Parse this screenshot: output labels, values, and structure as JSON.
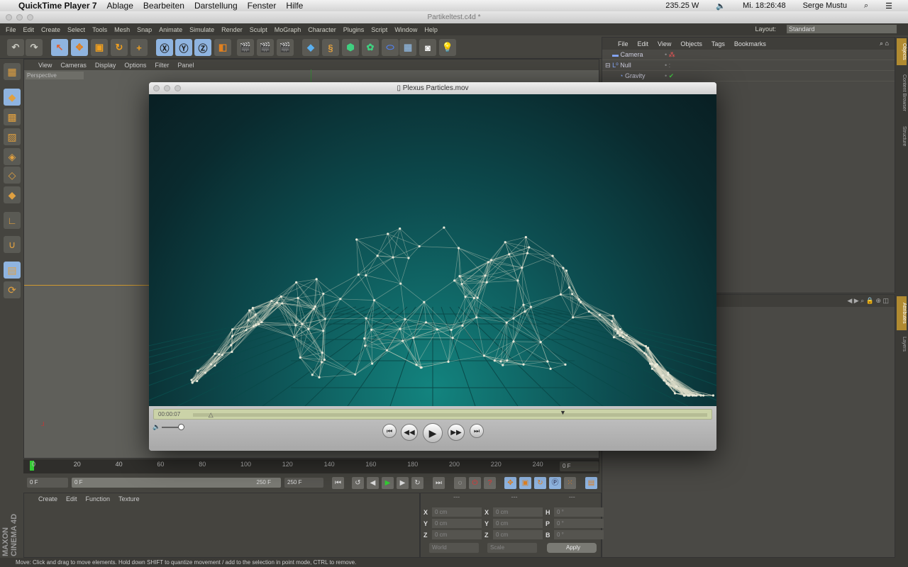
{
  "mac_menubar": {
    "app": "QuickTime Player 7",
    "items": [
      "Ablage",
      "Bearbeiten",
      "Darstellung",
      "Fenster",
      "Hilfe"
    ],
    "power": "235.25 W",
    "clock": "Mi. 18:26:48",
    "user": "Serge Mustu"
  },
  "c4d": {
    "title": "Partikeltest.c4d *",
    "menu": [
      "File",
      "Edit",
      "Create",
      "Select",
      "Tools",
      "Mesh",
      "Snap",
      "Animate",
      "Simulate",
      "Render",
      "Sculpt",
      "MoGraph",
      "Character",
      "Plugins",
      "Script",
      "Window",
      "Help"
    ],
    "layout_label": "Layout:",
    "layout_value": "Standard",
    "viewport_menu": [
      "View",
      "Cameras",
      "Display",
      "Options",
      "Filter",
      "Panel"
    ],
    "viewport_label": "Perspective",
    "object_manager": {
      "menu": [
        "File",
        "Edit",
        "View",
        "Objects",
        "Tags",
        "Bookmarks"
      ],
      "objects": [
        {
          "name": "Camera"
        },
        {
          "name": "Null"
        },
        {
          "name": "Gravity"
        }
      ]
    },
    "right_tabs": [
      "Objects",
      "Content Browser",
      "Structure",
      "Attributes",
      "Layers"
    ],
    "timeline": {
      "ticks": [
        "0",
        "20",
        "40",
        "60",
        "80",
        "100",
        "120",
        "140",
        "160",
        "180",
        "200",
        "220",
        "240"
      ],
      "current_frame": "0 F",
      "start": "0 F",
      "range_start": "0 F",
      "range_end": "250 F",
      "end": "250 F"
    },
    "material_menu": [
      "Create",
      "Edit",
      "Function",
      "Texture"
    ],
    "coords": {
      "headers": [
        "---",
        "---",
        "---"
      ],
      "rows": [
        [
          "X",
          "0 cm",
          "X",
          "0 cm",
          "H",
          "0 °"
        ],
        [
          "Y",
          "0 cm",
          "Y",
          "0 cm",
          "P",
          "0 °"
        ],
        [
          "Z",
          "0 cm",
          "Z",
          "0 cm",
          "B",
          "0 °"
        ]
      ],
      "mode1": "World",
      "mode2": "Scale",
      "apply": "Apply"
    },
    "status": "Move: Click and drag to move elements. Hold down SHIFT to quantize movement / add to the selection in point mode, CTRL to remove.",
    "brand": "MAXON CINEMA 4D"
  },
  "quicktime": {
    "title": "Plexus Particles.mov",
    "timecode": "00:00:07",
    "progress": 0.03,
    "volume": 0.8
  }
}
